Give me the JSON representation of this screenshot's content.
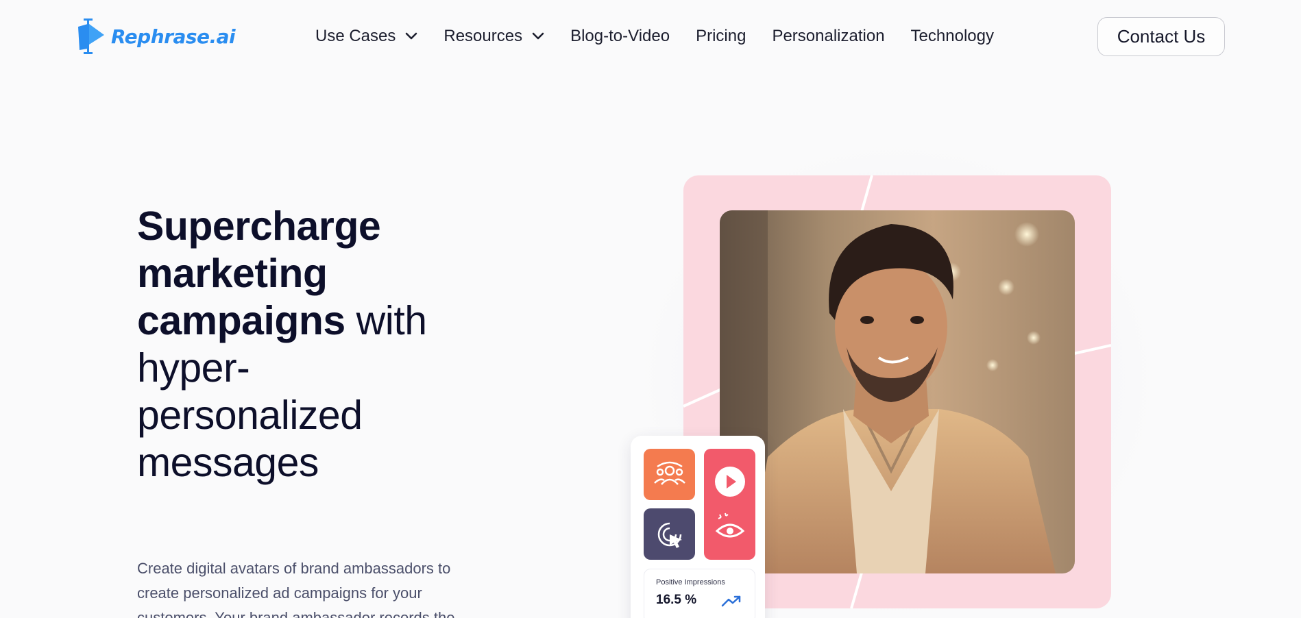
{
  "brand": {
    "name": "Rephrase.ai",
    "accent": "#2a8df0"
  },
  "nav": {
    "items": [
      {
        "label": "Use Cases",
        "dropdown": true
      },
      {
        "label": "Resources",
        "dropdown": true
      },
      {
        "label": "Blog-to-Video",
        "dropdown": false
      },
      {
        "label": "Pricing",
        "dropdown": false
      },
      {
        "label": "Personalization",
        "dropdown": false
      },
      {
        "label": "Technology",
        "dropdown": false
      }
    ],
    "cta_label": "Contact Us"
  },
  "hero": {
    "headline_bold_1": "Supercharge",
    "headline_bold_2": "marketing",
    "headline_bold_3": "campaigns",
    "headline_light_1": " with",
    "headline_light_2": "hyper-",
    "headline_light_3": "personalized",
    "headline_light_4": "messages",
    "subtext": "Create digital avatars of brand ambassadors to create personalized ad campaigns for your customers. Your brand ambassador records the"
  },
  "media": {
    "card_color": "#fbd8df",
    "stats": {
      "tiles": [
        {
          "icon": "audience-icon",
          "color": "#f47b4f"
        },
        {
          "icon": "play-icon",
          "color": "#f25a6b"
        },
        {
          "icon": "click-cursor-icon",
          "color": "#4d4a6e"
        },
        {
          "icon": "eye-sparkle-icon",
          "color": "#f25a6b"
        }
      ],
      "impressions_label": "Positive Impressions",
      "impressions_value": "16.5 %",
      "trend_icon": "trending-up-icon"
    }
  }
}
